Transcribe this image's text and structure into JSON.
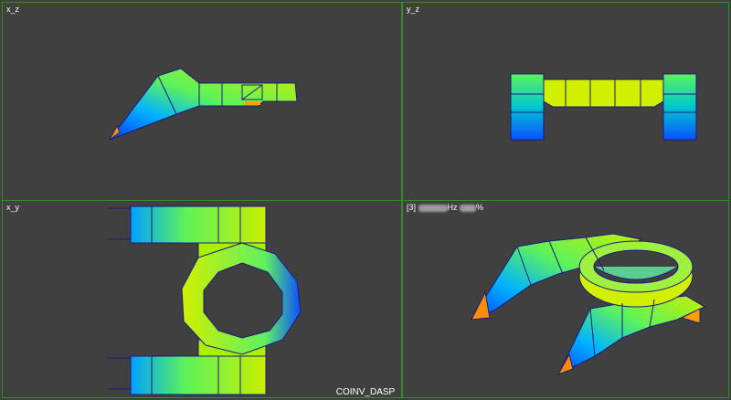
{
  "viewer": {
    "background": "#404040",
    "pane_border_color": "#2f8f2f",
    "panes": [
      {
        "id": "xz",
        "label": "x_z"
      },
      {
        "id": "yz",
        "label": "y_z"
      },
      {
        "id": "xy",
        "label": "x_y"
      },
      {
        "id": "iso",
        "label_prefix": "[3]",
        "label_unit": "Hz",
        "label_suffix": "%"
      }
    ],
    "footer_title": "COINV_DASP",
    "colormap": [
      "#0a3cff",
      "#00b4ff",
      "#00e0c0",
      "#5cf25c",
      "#c8f000",
      "#ff8c00"
    ]
  }
}
